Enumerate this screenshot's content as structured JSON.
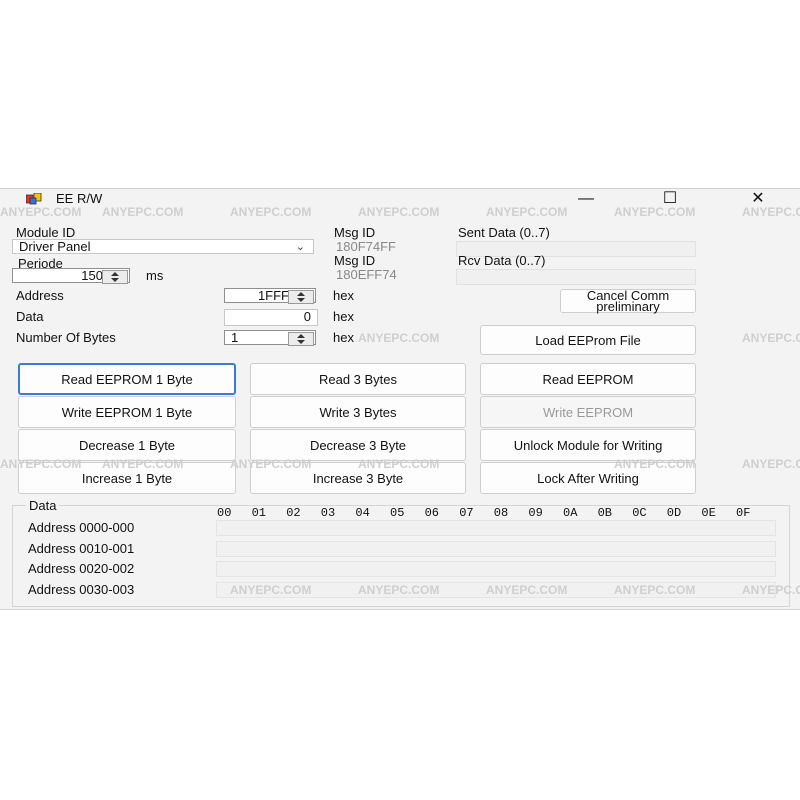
{
  "window": {
    "title": "EE R/W",
    "minimize": "—",
    "maximize": "☐",
    "close": "✕"
  },
  "labels": {
    "module_id": "Module ID",
    "periode": "Periode",
    "ms": "ms",
    "address": "Address",
    "data": "Data",
    "number_of_bytes": "Number Of Bytes",
    "hex1": "hex",
    "hex2": "hex",
    "hex3": "hex",
    "msg_id_1": "Msg ID",
    "msg_id_2": "Msg ID",
    "sent_data": "Sent Data (0..7)",
    "rcv_data": "Rcv Data (0..7)"
  },
  "values": {
    "module": "Driver Panel",
    "periode": "150",
    "address": "1FFF",
    "data": "0",
    "number_of_bytes": "1",
    "msg_id_1": "180F74FF",
    "msg_id_2": "180EFF74"
  },
  "buttons": {
    "cancel_comm": "Cancel Comm preliminary",
    "load_eeprom_file": "Load EEProm File",
    "read_1": "Read EEPROM 1 Byte",
    "read_3": "Read 3 Bytes",
    "read_all": "Read EEPROM",
    "write_1": "Write EEPROM 1 Byte",
    "write_3": "Write 3 Bytes",
    "write_all": "Write EEPROM",
    "dec_1": "Decrease 1 Byte",
    "dec_3": "Decrease 3 Byte",
    "unlock": "Unlock Module for Writing",
    "inc_1": "Increase 1 Byte",
    "inc_3": "Increase 3 Byte",
    "lock": "Lock After Writing"
  },
  "data_group": {
    "title": "Data",
    "columns": [
      "00",
      "01",
      "02",
      "03",
      "04",
      "05",
      "06",
      "07",
      "08",
      "09",
      "0A",
      "0B",
      "0C",
      "0D",
      "0E",
      "0F"
    ],
    "rows": [
      "Address 0000-000",
      "Address 0010-001",
      "Address 0020-002",
      "Address 0030-003"
    ]
  },
  "watermark": "ANYEPC.COM"
}
